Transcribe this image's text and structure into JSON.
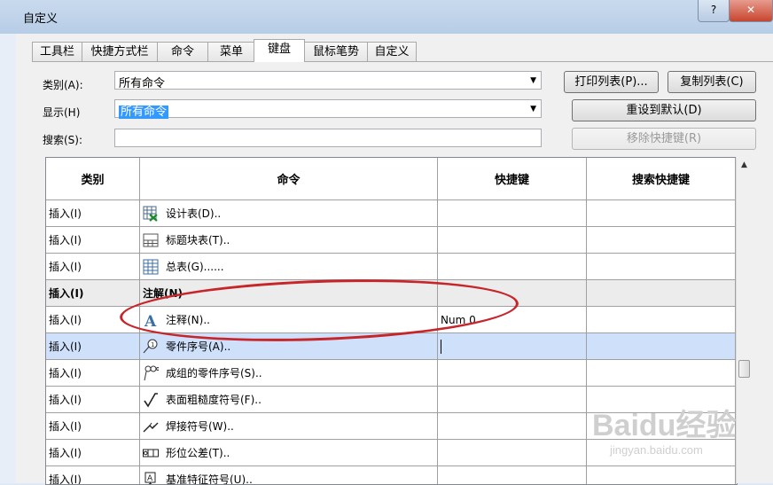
{
  "window": {
    "title": "自定义",
    "help_label": "?",
    "close_label": "✕"
  },
  "tabs": [
    "工具栏",
    "快捷方式栏",
    "命令",
    "菜单",
    "键盘",
    "鼠标笔势",
    "自定义"
  ],
  "active_tab": "键盘",
  "filters": {
    "category_label": "类别(A):",
    "category_value": "所有命令",
    "display_label": "显示(H)",
    "display_value": "所有命令",
    "search_label": "搜索(S):",
    "search_value": ""
  },
  "buttons": {
    "print": "打印列表(P)...",
    "copy": "复制列表(C)",
    "reset": "重设到默认(D)",
    "remove": "移除快捷键(R)"
  },
  "table": {
    "columns": [
      "类别",
      "命令",
      "快捷键",
      "搜索快捷键"
    ],
    "rows": [
      {
        "category": "插入(I)",
        "icon": "design-table-icon",
        "command": "设计表(D)..",
        "shortcut": "",
        "search": "",
        "type": "normal"
      },
      {
        "category": "插入(I)",
        "icon": "title-block-table-icon",
        "command": "标题块表(T)..",
        "shortcut": "",
        "search": "",
        "type": "normal"
      },
      {
        "category": "插入(I)",
        "icon": "general-table-icon",
        "command": "总表(G)......",
        "shortcut": "",
        "search": "",
        "type": "normal"
      },
      {
        "category": "插入(I)",
        "icon": "",
        "command": "注解(N)",
        "shortcut": "",
        "search": "",
        "type": "group"
      },
      {
        "category": "插入(I)",
        "icon": "note-icon",
        "command": "注释(N)..",
        "shortcut": "Num 0",
        "search": "",
        "type": "normal"
      },
      {
        "category": "插入(I)",
        "icon": "balloon-icon",
        "command": "零件序号(A)..",
        "shortcut": "",
        "search": "",
        "type": "selected"
      },
      {
        "category": "插入(I)",
        "icon": "stacked-balloon-icon",
        "command": "成组的零件序号(S)..",
        "shortcut": "",
        "search": "",
        "type": "normal"
      },
      {
        "category": "插入(I)",
        "icon": "surface-finish-icon",
        "command": "表面粗糙度符号(F)..",
        "shortcut": "",
        "search": "",
        "type": "normal"
      },
      {
        "category": "插入(I)",
        "icon": "weld-symbol-icon",
        "command": "焊接符号(W)..",
        "shortcut": "",
        "search": "",
        "type": "normal"
      },
      {
        "category": "插入(I)",
        "icon": "geometric-tolerance-icon",
        "command": "形位公差(T)..",
        "shortcut": "",
        "search": "",
        "type": "normal"
      },
      {
        "category": "插入(I)",
        "icon": "datum-feature-icon",
        "command": "基准特征符号(U)..",
        "shortcut": "",
        "search": "",
        "type": "normal"
      }
    ]
  },
  "colors": {
    "selected_row": "#cfe0fb",
    "group_row": "#ececec",
    "annotation_oval": "#c6252a",
    "selection_highlight": "#3399ff"
  },
  "watermark": {
    "main": "Baidu经验",
    "sub": "jingyan.baidu.com"
  }
}
